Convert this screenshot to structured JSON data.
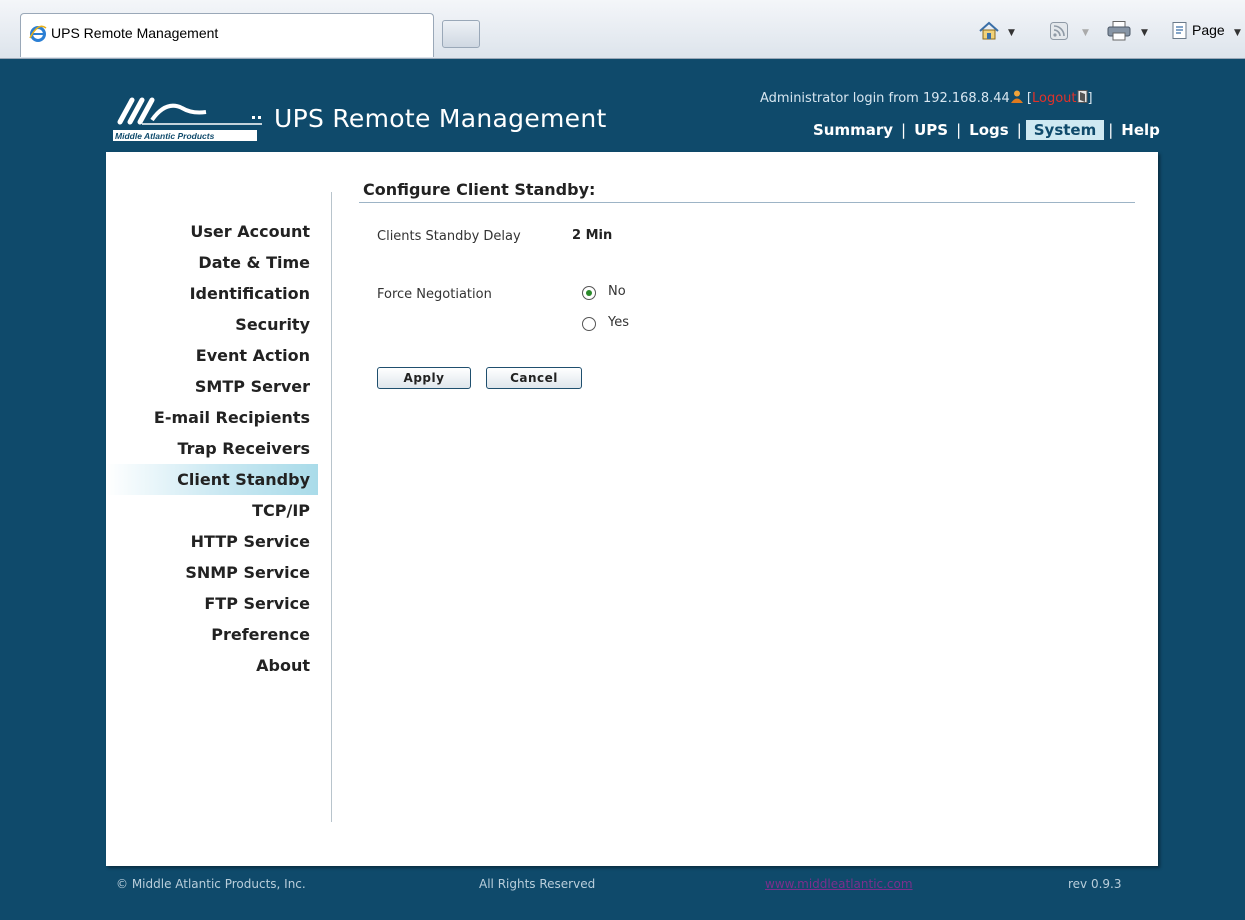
{
  "browser": {
    "tab_title": "UPS Remote Management",
    "page_menu": "Page"
  },
  "header": {
    "logo_text": "Middle Atlantic Products",
    "app_title": "UPS Remote Management",
    "login_prefix": "Administrator login from 192.168.8.44",
    "logout_open": "[",
    "logout_label": "Logout",
    "logout_close": "]",
    "nav": {
      "summary": "Summary",
      "ups": "UPS",
      "logs": "Logs",
      "system": "System",
      "help": "Help"
    },
    "active_nav": "System"
  },
  "sidebar": {
    "items": [
      {
        "label": "User Account"
      },
      {
        "label": "Date & Time"
      },
      {
        "label": "Identification"
      },
      {
        "label": "Security"
      },
      {
        "label": "Event Action"
      },
      {
        "label": "SMTP Server"
      },
      {
        "label": "E-mail Recipients"
      },
      {
        "label": "Trap Receivers"
      },
      {
        "label": "Client Standby"
      },
      {
        "label": "TCP/IP"
      },
      {
        "label": "HTTP Service"
      },
      {
        "label": "SNMP Service"
      },
      {
        "label": "FTP Service"
      },
      {
        "label": "Preference"
      },
      {
        "label": "About"
      }
    ],
    "active": "Client Standby"
  },
  "main": {
    "section_title": "Configure Client Standby:",
    "standby_delay_label": "Clients Standby Delay",
    "standby_delay_value": "2 Min",
    "force_negotiation_label": "Force Negotiation",
    "options": [
      {
        "label": "No",
        "selected": true
      },
      {
        "label": "Yes",
        "selected": false
      }
    ],
    "apply_label": "Apply",
    "cancel_label": "Cancel"
  },
  "footer": {
    "copyright": "© Middle Atlantic Products, Inc.",
    "rights": "All Rights Reserved",
    "link": "www.middleatlantic.com",
    "version": "rev 0.9.3"
  },
  "colors": {
    "background": "#0f4a6b",
    "active_highlight": "#cfe9f2",
    "logout": "#e0322a",
    "radio_selected": "#2a8a2a"
  }
}
